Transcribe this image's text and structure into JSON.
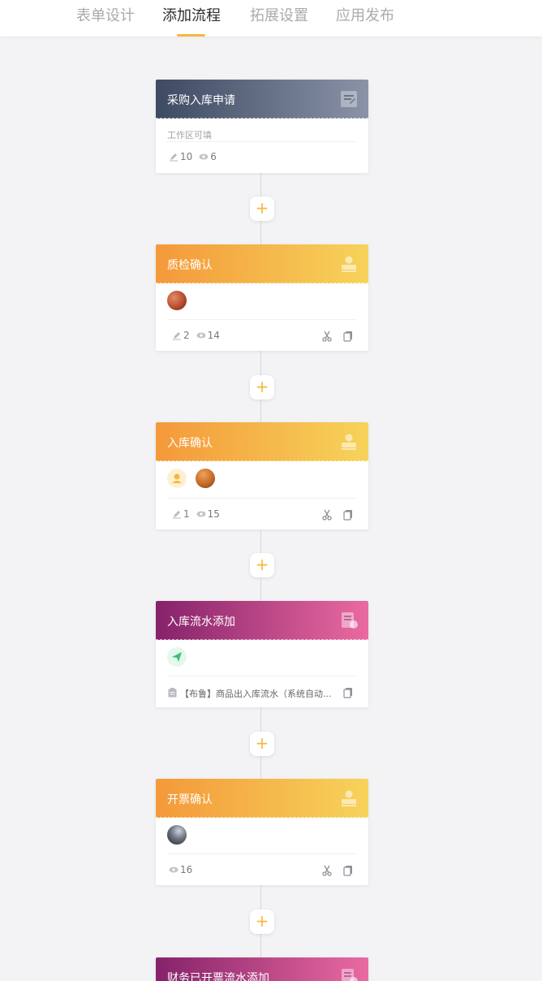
{
  "tabs": [
    {
      "label": "表单设计"
    },
    {
      "label": "添加流程"
    },
    {
      "label": "拓展设置"
    },
    {
      "label": "应用发布"
    }
  ],
  "active_tab": "添加流程",
  "add_button_label": "+",
  "nodes": [
    {
      "title": "采购入库申请",
      "placeholder": "工作区可填",
      "edits": "10",
      "views": "6"
    },
    {
      "title": "质检确认",
      "edits": "2",
      "views": "14"
    },
    {
      "title": "入库确认",
      "edits": "1",
      "views": "15"
    },
    {
      "title": "入库流水添加",
      "note": "【布鲁】商品出入库流水（系统自动..."
    },
    {
      "title": "开票确认",
      "views": "16"
    },
    {
      "title": "财务已开票流水添加"
    }
  ],
  "colors": {
    "accent": "#f5b83d",
    "header_dark": [
      "#3d4a62",
      "#8a93a7"
    ],
    "header_orange": [
      "#f4993a",
      "#f6d35a"
    ],
    "header_purple": [
      "#86226a",
      "#ea6aa1"
    ]
  },
  "icons": [
    "form-icon",
    "approver-icon",
    "data-add-icon",
    "pencil-icon",
    "eye-icon",
    "scissors-icon",
    "copy-icon",
    "clipboard-icon",
    "send-icon",
    "user-icon"
  ]
}
